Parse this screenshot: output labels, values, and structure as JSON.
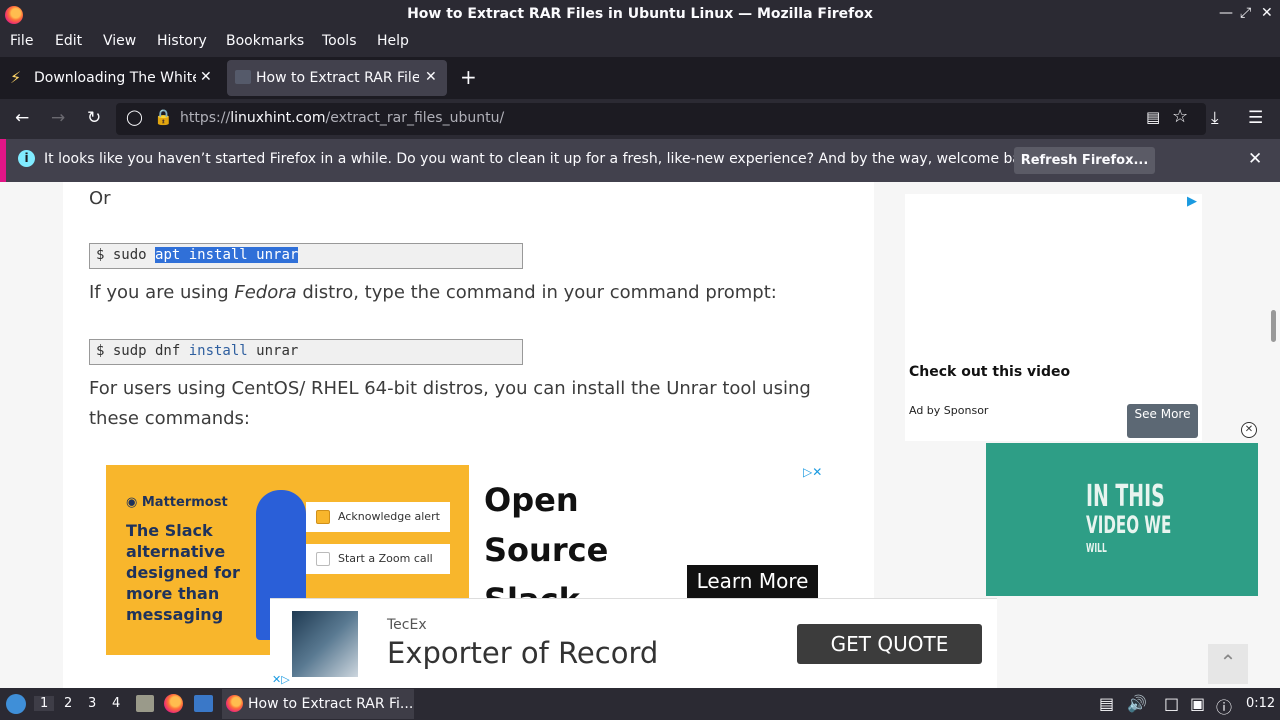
{
  "window": {
    "title": "How to Extract RAR Files in Ubuntu Linux — Mozilla Firefox"
  },
  "menu": [
    "File",
    "Edit",
    "View",
    "History",
    "Bookmarks",
    "Tools",
    "Help"
  ],
  "tabs": [
    {
      "label": "Downloading The White H",
      "active": false
    },
    {
      "label": "How to Extract RAR Files",
      "active": true
    }
  ],
  "url": {
    "scheme": "https://",
    "host": "linuxhint.com",
    "path": "/extract_rar_files_ubuntu/"
  },
  "notification": {
    "message": "It looks like you haven’t started Firefox in a while. Do you want to clean it up for a fresh, like-new experience? And by the way, welcome back!",
    "button": "Refresh Firefox..."
  },
  "article": {
    "or": "Or",
    "code1": {
      "prompt": "$ sudo ",
      "selected": "apt install unrar"
    },
    "fedora_pre": "If you are using ",
    "fedora_em": "Fedora",
    "fedora_post": " distro, type the command in your command prompt:",
    "code2": {
      "prompt": "$ sudp dnf ",
      "kw": "install",
      "rest": " unrar"
    },
    "centos_line1": "For users using CentOS/ RHEL 64-bit distros, you can install the Unrar tool using",
    "centos_line2": "these commands:"
  },
  "side_ad": {
    "headline": "Check out this video",
    "by": "Ad by Sponsor",
    "button": "See More"
  },
  "video_ad": {
    "line1": "IN THIS",
    "line2": "VIDEO WE",
    "line3": "WILL"
  },
  "mm_ad": {
    "logo": "Mattermost",
    "copy": "The Slack alternative designed for more than messaging",
    "card1": "Acknowledge alert",
    "card2": "Start a Zoom call",
    "big1": "Open",
    "big2": "Source",
    "big3": "Slack",
    "button": "Learn More"
  },
  "bottom_ad": {
    "brand": "TecEx",
    "headline": "Exporter of Record",
    "button": "GET QUOTE"
  },
  "taskbar": {
    "workspaces": [
      "1",
      "2",
      "3",
      "4"
    ],
    "active_window": "How to Extract RAR Fi...",
    "clock": "0:12"
  }
}
